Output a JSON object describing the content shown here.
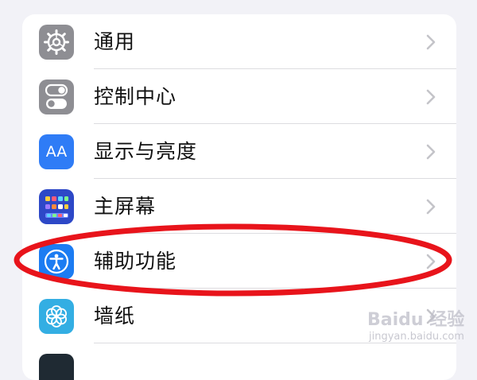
{
  "settings_list": {
    "items": [
      {
        "label": "通用",
        "icon": "gear-icon",
        "icon_color": "#8e8e93"
      },
      {
        "label": "控制中心",
        "icon": "toggle-switches-icon",
        "icon_color": "#8e8e93"
      },
      {
        "label": "显示与亮度",
        "icon": "text-size-aa-icon",
        "icon_color": "#2f7cf6"
      },
      {
        "label": "主屏幕",
        "icon": "home-screen-grid-icon",
        "icon_color": "#2d48c7"
      },
      {
        "label": "辅助功能",
        "icon": "accessibility-person-icon",
        "icon_color": "#1c7cf2"
      },
      {
        "label": "墙纸",
        "icon": "flower-icon",
        "icon_color": "#33aee3"
      }
    ]
  },
  "icon_text": {
    "display_aa": "AA"
  },
  "annotation": {
    "color": "#e8141b"
  },
  "watermark": {
    "brand": "Baidu 经验",
    "url": "jingyan.baidu.com"
  }
}
